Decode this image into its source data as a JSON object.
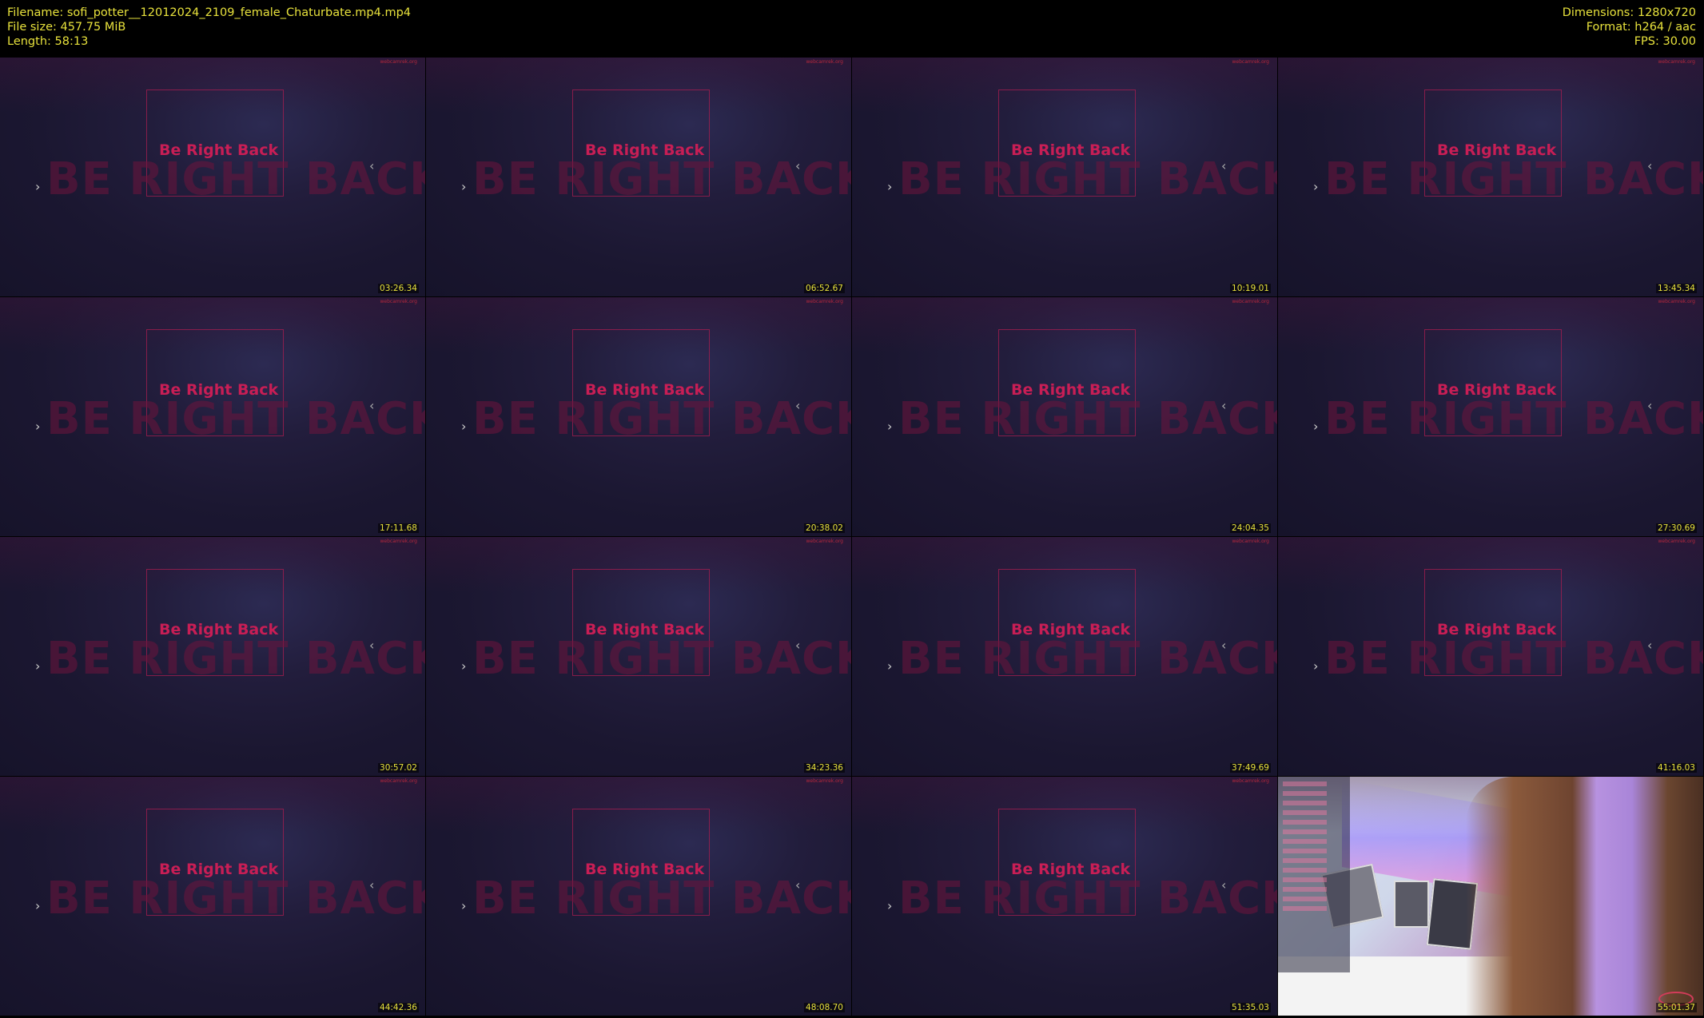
{
  "header": {
    "filename": "Filename: sofi_potter__12012024_2109_female_Chaturbate.mp4.mp4",
    "filesize": "File size: 457.75 MiB",
    "length": "Length: 58:13",
    "dimensions": "Dimensions: 1280x720",
    "format": "Format: h264 / aac",
    "fps": "FPS: 30.00"
  },
  "frame": {
    "small_text": "Be Right Back",
    "big_text": "BE RIGHT BACK",
    "watermark": "webcamrek.org",
    "arrow_left": "›",
    "arrow_right": "‹"
  },
  "thumbnails": [
    {
      "timestamp": "03:26.34",
      "kind": "brb"
    },
    {
      "timestamp": "06:52.67",
      "kind": "brb"
    },
    {
      "timestamp": "10:19.01",
      "kind": "brb"
    },
    {
      "timestamp": "13:45.34",
      "kind": "brb"
    },
    {
      "timestamp": "17:11.68",
      "kind": "brb"
    },
    {
      "timestamp": "20:38.02",
      "kind": "brb"
    },
    {
      "timestamp": "24:04.35",
      "kind": "brb"
    },
    {
      "timestamp": "27:30.69",
      "kind": "brb"
    },
    {
      "timestamp": "30:57.02",
      "kind": "brb"
    },
    {
      "timestamp": "34:23.36",
      "kind": "brb"
    },
    {
      "timestamp": "37:49.69",
      "kind": "brb"
    },
    {
      "timestamp": "41:16.03",
      "kind": "brb"
    },
    {
      "timestamp": "44:42.36",
      "kind": "brb"
    },
    {
      "timestamp": "48:08.70",
      "kind": "brb"
    },
    {
      "timestamp": "51:35.03",
      "kind": "brb"
    },
    {
      "timestamp": "55:01.37",
      "kind": "cam"
    }
  ]
}
